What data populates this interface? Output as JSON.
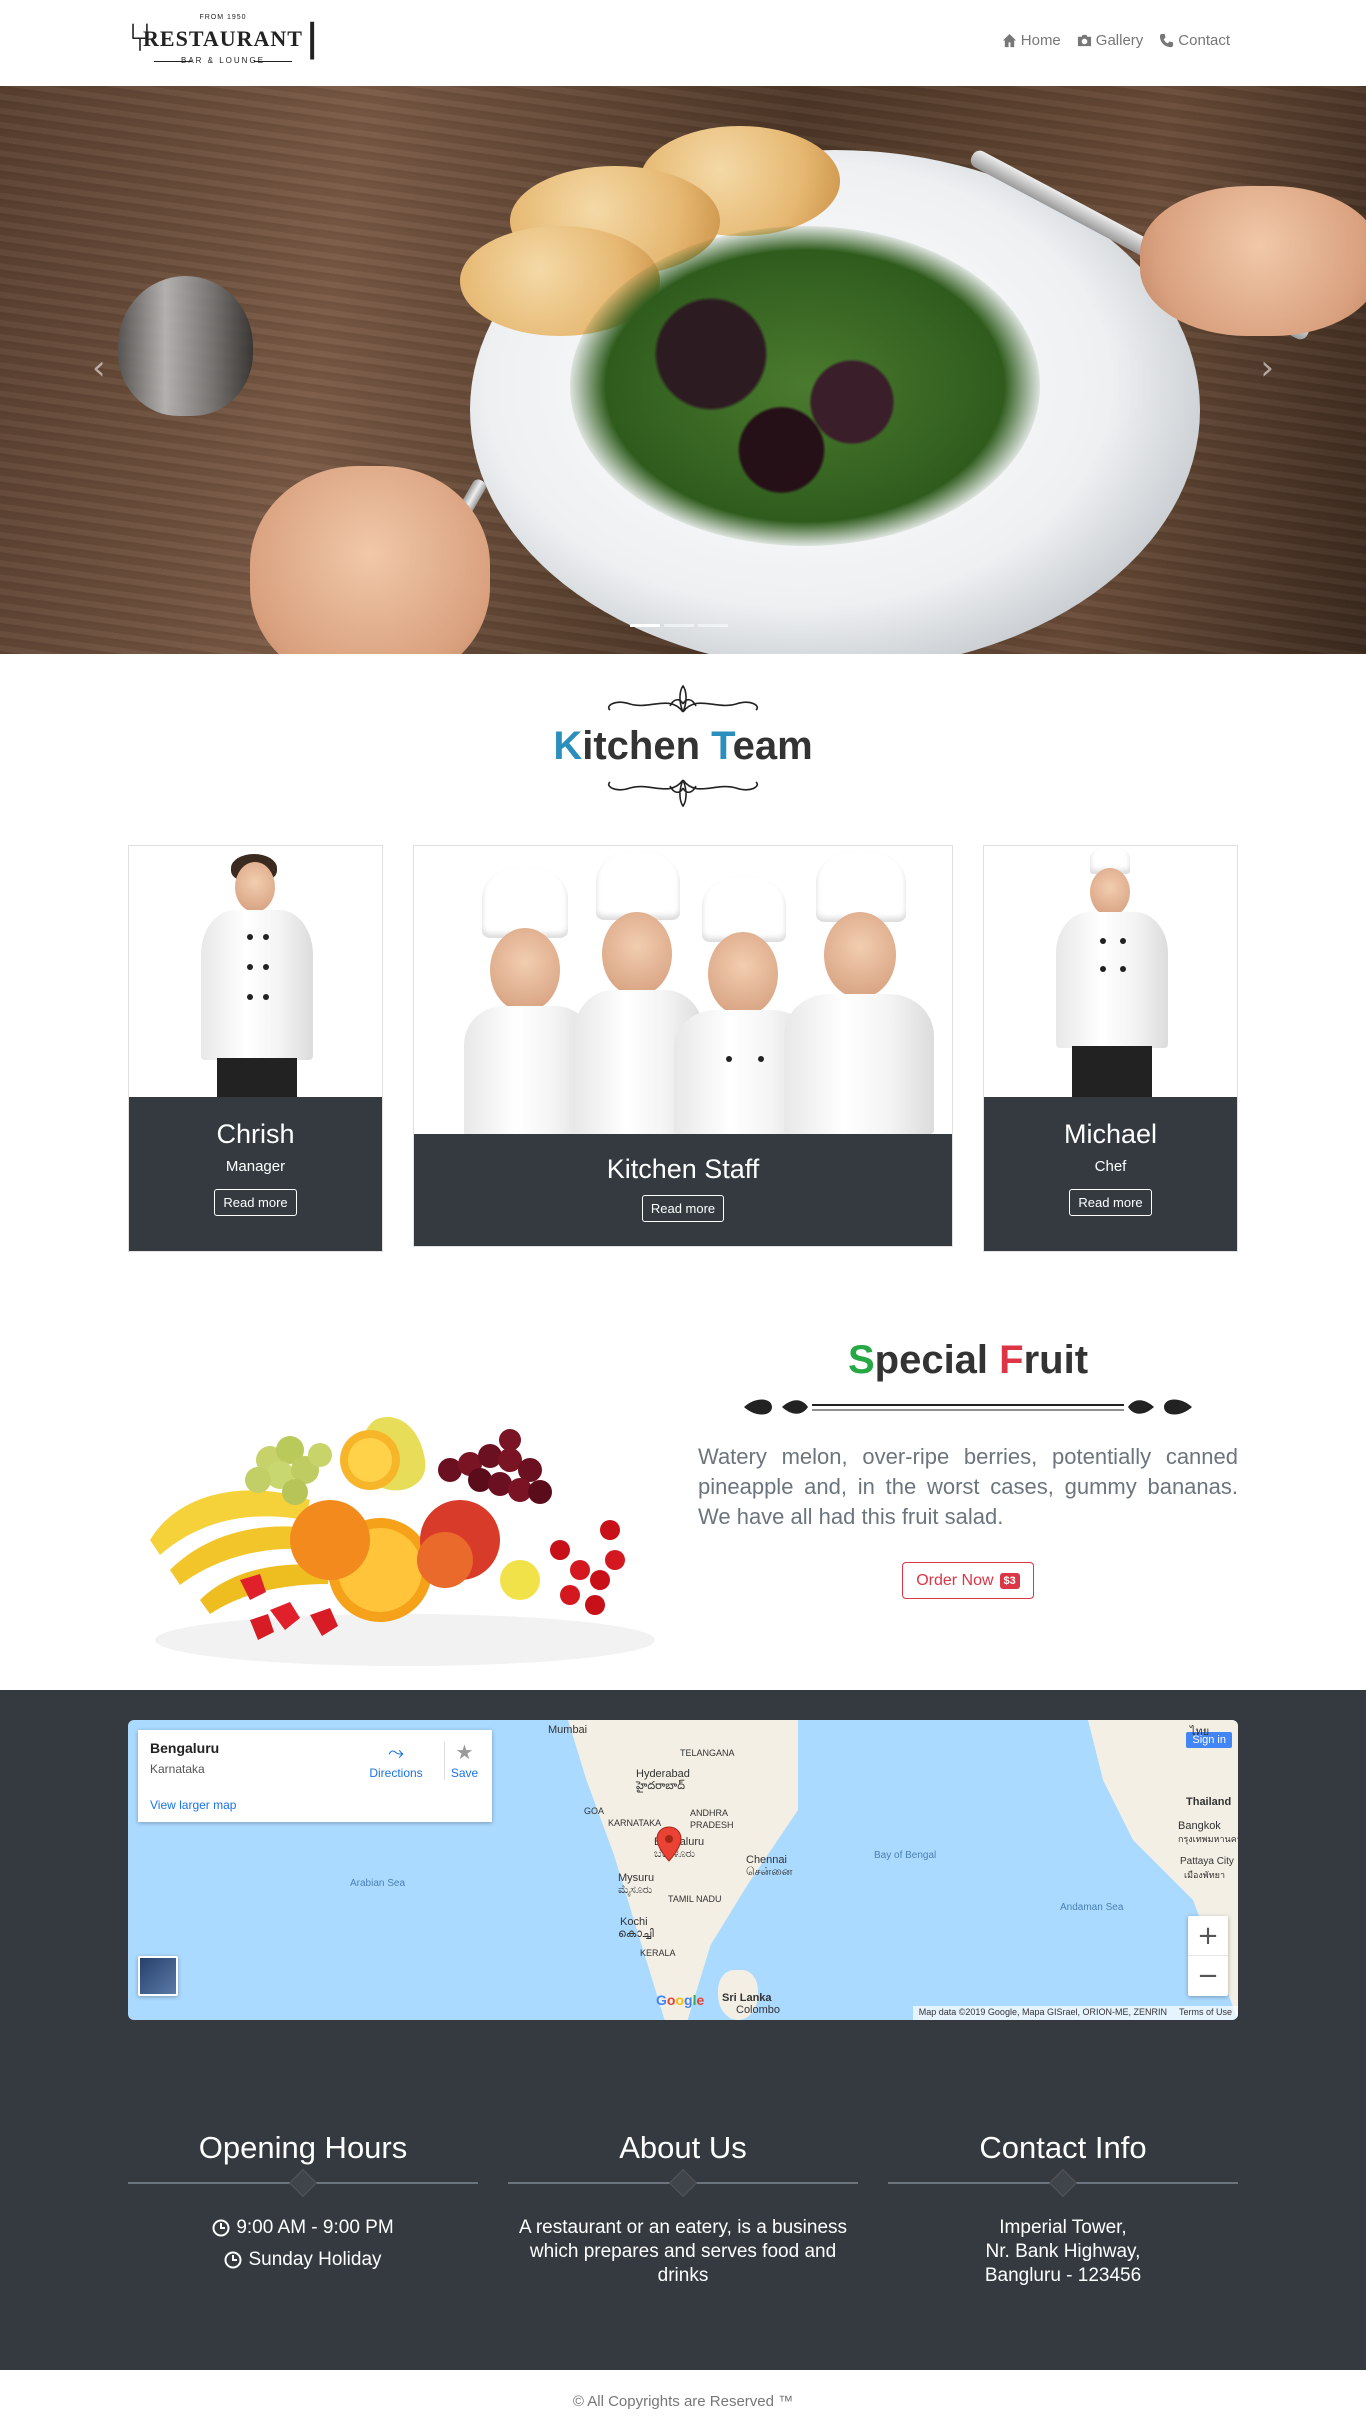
{
  "brand": {
    "from": "FROM 1950",
    "name": "RESTAURANT",
    "sub": "BAR & LOUNGE"
  },
  "nav": [
    {
      "label": "Home",
      "icon": "home-icon"
    },
    {
      "label": "Gallery",
      "icon": "camera-icon"
    },
    {
      "label": "Contact",
      "icon": "phone-icon"
    }
  ],
  "carousel": {
    "prev": "‹",
    "next": "›",
    "slides": 3,
    "active": 0
  },
  "team": {
    "title_first": "K",
    "title_rest1": "itchen ",
    "title_second": "T",
    "title_rest2": "eam",
    "members": [
      {
        "name": "Chrish",
        "role": "Manager",
        "button": "Read more"
      },
      {
        "name": "Kitchen Staff",
        "role": "",
        "button": "Read more"
      },
      {
        "name": "Michael",
        "role": "Chef",
        "button": "Read more"
      }
    ]
  },
  "fruit": {
    "title_s": "S",
    "title_rest1": "pecial ",
    "title_f": "F",
    "title_rest2": "ruit",
    "text": "Watery melon, over-ripe berries, potentially canned pineapple and, in the worst cases, gummy bananas. We have all had this fruit salad.",
    "button": "Order Now",
    "price": "$3"
  },
  "map": {
    "city": "Bengaluru",
    "state": "Karnataka",
    "directions": "Directions",
    "save": "Save",
    "larger": "View larger map",
    "signin": "Sign in",
    "zoom_in": "+",
    "zoom_out": "−",
    "google": "Google",
    "data": "Map data ©2019 Google, Mapa GISrael, ORION-ME, ZENRIN",
    "terms": "Terms of Use",
    "labels": {
      "mumbai": "Mumbai",
      "telangana": "TELANGANA",
      "hyderabad": "Hyderabad",
      "hyderabad_te": "హైదరాబాద్",
      "goa": "GOA",
      "karnataka": "KARNATAKA",
      "andhra": "ANDHRA",
      "pradesh": "PRADESH",
      "bengaluru": "Bengaluru",
      "bengaluru_kn": "ಬೆಂಗಳೂರು",
      "chennai": "Chennai",
      "chennai_ta": "சென்னை",
      "mysuru": "Mysuru",
      "mysuru_kn": "ಮೈಸೂರು",
      "tamil": "TAMIL NADU",
      "kochi": "Kochi",
      "kochi_ml": "കൊച്ചി",
      "kerala": "KERALA",
      "srilanka": "Sri Lanka",
      "colombo": "Colombo",
      "arabian": "Arabian Sea",
      "bengal": "Bay of Bengal",
      "andaman": "Andaman Sea",
      "thailand_th": "ไทย",
      "thailand": "Thailand",
      "bangkok": "Bangkok",
      "bangkok_th": "กรุงเทพมหานคร",
      "pattaya": "Pattaya City",
      "pattaya_th": "เมืองพัทยา"
    }
  },
  "footer": {
    "hours": {
      "title": "Opening Hours",
      "line1": "9:00 AM - 9:00 PM",
      "line2": "Sunday Holiday"
    },
    "about": {
      "title": "About Us",
      "text": "A restaurant or an eatery, is a business which prepares and serves food and drinks"
    },
    "contact": {
      "title": "Contact Info",
      "line1": "Imperial Tower,",
      "line2": "Nr. Bank Highway,",
      "line3": "Bangluru - 123456"
    }
  },
  "copyright": "© All Copyrights are Reserved ™",
  "colors": {
    "accent_blue": "#2a8fbd",
    "accent_green": "#28a745",
    "accent_red": "#dc3545",
    "dark": "#343a40"
  }
}
